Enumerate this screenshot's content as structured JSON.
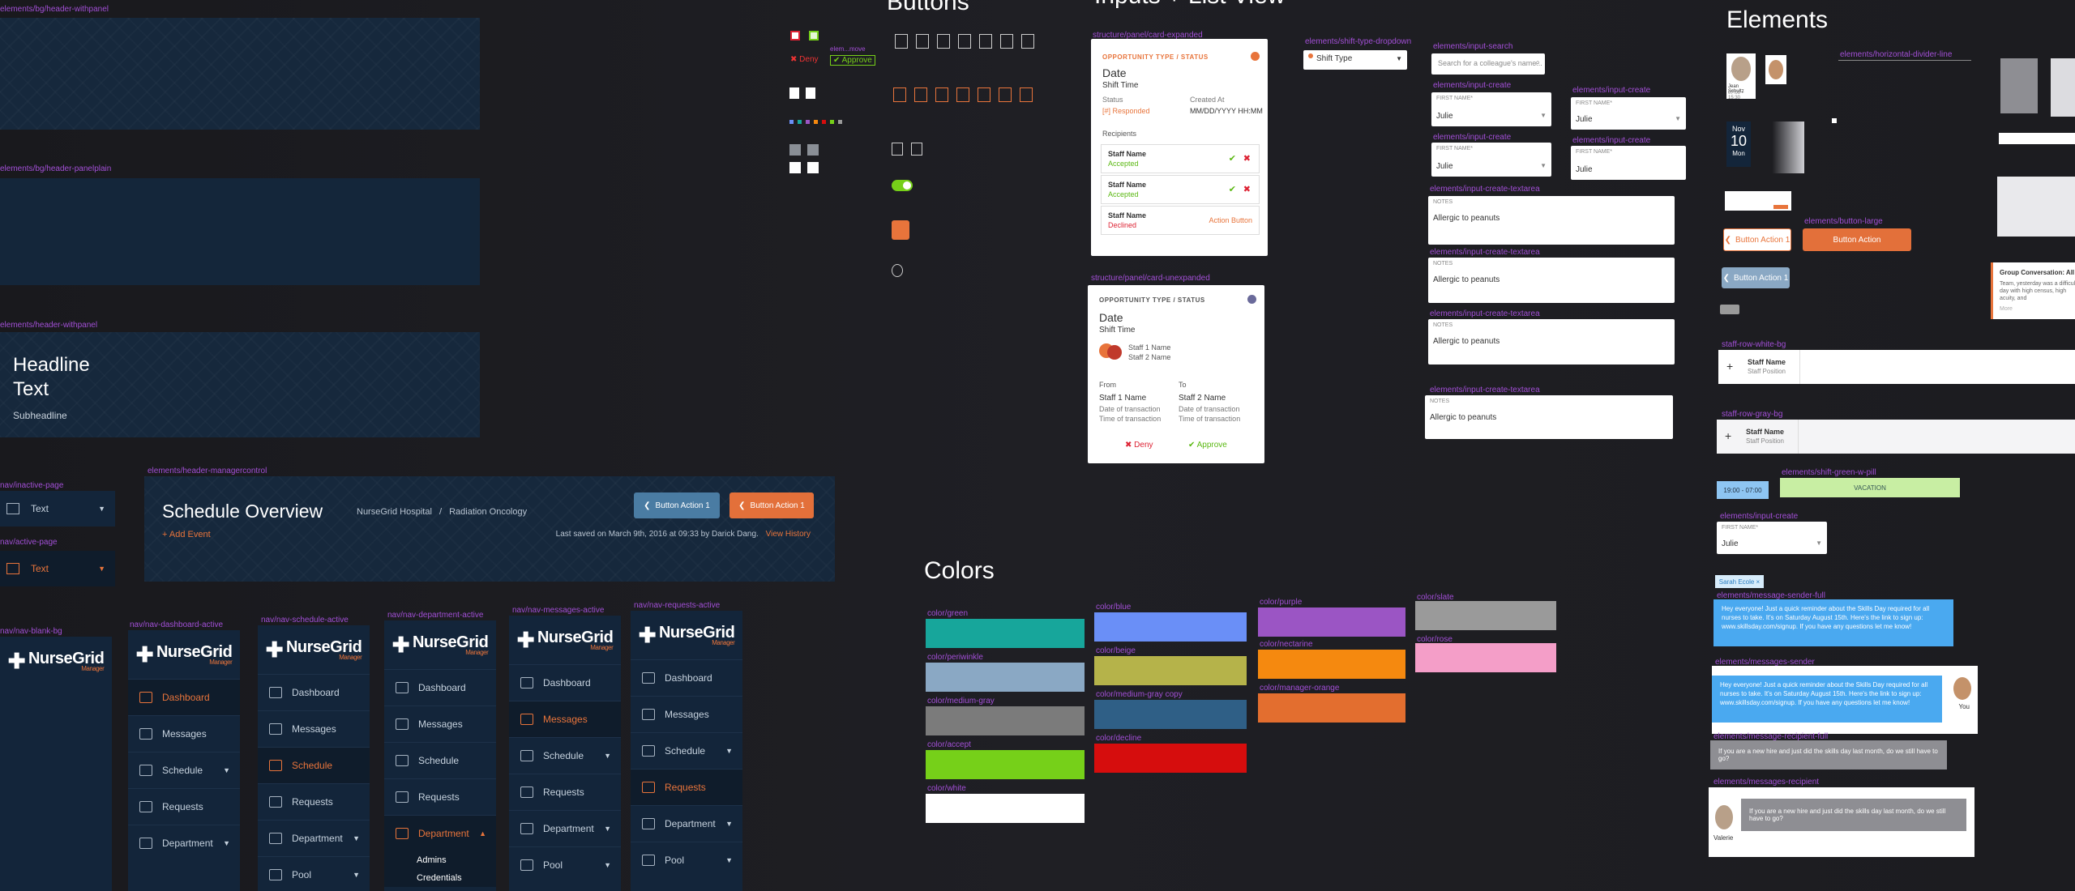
{
  "labels": {
    "bg_withpanel": "elements/bg/header-withpanel",
    "bg_panelplain": "elements/bg/header-panelplain",
    "header_withpanel": "elements/header-withpanel",
    "nav_inactive": "nav/inactive-page",
    "nav_active": "nav/active-page",
    "header_manager": "elements/header-managercontrol",
    "nav_blank": "nav/nav-blank-bg",
    "nav_dashboard": "nav/nav-dashboard-active",
    "nav_schedule": "nav/nav-schedule-active",
    "nav_department": "nav/nav-department-active",
    "nav_messages": "nav/nav-messages-active",
    "nav_requests": "nav/nav-requests-active",
    "card_expanded": "structure/panel/card-expanded",
    "card_unexpanded": "structure/panel/card-unexpanded",
    "shift_dropdown": "elements/shift-type-dropdown",
    "input_search": "elements/input-search",
    "input_create": "elements/input-create",
    "input_textarea": "elements/input-create-textarea",
    "hr": "elements/horizontal-divider-line",
    "button_large": "elements/button-large",
    "staff_row_white": "staff-row-white-bg",
    "staff_row_gray": "staff-row-gray-bg",
    "shift_green": "elements/shift-green-w-pill",
    "input_create2": "elements/input-create",
    "msg_sender_full": "elements/message-sender-full",
    "msg_sender": "elements/messages-sender",
    "msg_recipient_full": "elements/message-recipient-full",
    "msg_recipient": "elements/messages-recipient",
    "color_green": "color/green",
    "color_blue": "color/blue",
    "color_purple": "color/purple",
    "color_slate": "color/slate",
    "color_periwinkle": "color/periwinkle",
    "color_beige": "color/beige",
    "color_nectarine": "color/nectarine",
    "color_rose": "color/rose",
    "color_mediumgray": "color/medium-gray",
    "color_mediumgray_copy": "color/medium-gray copy",
    "color_manager_orange": "color/manager-orange",
    "color_accept": "color/accept",
    "color_decline": "color/decline",
    "color_white": "color/white",
    "elem_deny": "elem...move"
  },
  "headings": {
    "buttons": "Buttons",
    "inputs": "Inputs + List View",
    "colors": "Colors",
    "elements": "Elements"
  },
  "header_withpanel": {
    "headline": "Headline Text",
    "subheadline": "Subheadline"
  },
  "nav_single": {
    "text": "Text"
  },
  "manager_header": {
    "title": "Schedule Overview",
    "hospital": "NurseGrid Hospital",
    "separator": "/",
    "department": "Radiation Oncology",
    "add_event": "+ Add Event",
    "button1": "Button Action 1",
    "button2": "Button Action 1",
    "last_saved": "Last saved on March 9th, 2016 at 09:33 by Darick Dang.",
    "view_history": "View History"
  },
  "nav_logo": {
    "name": "NurseGrid",
    "sub": "Manager"
  },
  "nav_items": {
    "dashboard": "Dashboard",
    "messages": "Messages",
    "schedule": "Schedule",
    "requests": "Requests",
    "department": "Department",
    "pool": "Pool",
    "admins": "Admins",
    "credentials": "Credentials"
  },
  "card_expanded": {
    "type": "OPPORTUNITY TYPE / STATUS",
    "date": "Date",
    "shift_time": "Shift Time",
    "status_label": "Status",
    "status_value": "[#] Responded",
    "created_label": "Created At",
    "created_value": "MM/DD/YYYY  HH:MM",
    "recipients": "Recipients",
    "staff1": "Staff Name",
    "staff1_status": "Accepted",
    "staff2": "Staff Name",
    "staff2_status": "Accepted",
    "staff3": "Staff Name",
    "staff3_status": "Declined",
    "action": "Action Button"
  },
  "card_unexpanded": {
    "type": "OPPORTUNITY TYPE / STATUS",
    "date": "Date",
    "shift_time": "Shift Time",
    "staff1": "Staff 1 Name",
    "staff2": "Staff 2 Name",
    "from": "From",
    "to": "To",
    "from_name": "Staff 1 Name",
    "to_name": "Staff 2 Name",
    "date_tx": "Date of transaction",
    "time_tx": "Time of transaction",
    "deny": "Deny",
    "approve": "Approve"
  },
  "buttons_area": {
    "deny": "Deny",
    "approve": "Approve"
  },
  "dropdown": {
    "value": "Shift Type"
  },
  "search": {
    "placeholder": "Search for a colleague's name..."
  },
  "input_create": {
    "label": "FIRST NAME*",
    "value": "Julie"
  },
  "textarea": {
    "label": "NOTES",
    "value": "Allergic to peanuts"
  },
  "elements_panel": {
    "btn_outline": "Button Action 1",
    "btn_large": "Button Action",
    "btn_back": "Button Action 1",
    "staff_name": "Staff Name",
    "staff_position": "Staff Position",
    "shift_time": "19:00 - 07:00",
    "vacation": "VACATION",
    "first_name_label": "FIRST NAME*",
    "first_name_value": "Julie",
    "sarah_pill": "Sarah Ecole ×",
    "sender_msg": "Hey everyone! Just a quick reminder about the Skills Day required for all nurses to take. It's on Saturday August 15th. Here's the link to sign up: www.skillsday.com/signup. If you have any questions let me know!",
    "recipient_msg": "If you are a new hire and just did the skills day last month, do we still have to go?",
    "you": "You",
    "valerie": "Valerie",
    "date_month": "Nov",
    "date_day": "10",
    "date_dow": "Mon",
    "avatar_name": "Jean Schultz",
    "avatar_time": "07:00 - 15:30",
    "group_title": "Group Conversation: All",
    "group_body": "Team, yesterday was a difficult day with high census, high acuity, and",
    "group_more": "More"
  },
  "colors": {
    "green": "#17a69b",
    "blue": "#6a8ff7",
    "purple": "#9b55c4",
    "slate": "#9a9a9a",
    "periwinkle": "#8aa8c4",
    "beige": "#b5b34a",
    "nectarine": "#f5890f",
    "rose": "#f49ec8",
    "mediumgray": "#7b7b7b",
    "mediumgray_copy": "#2f5f86",
    "manager_orange": "#e36e2f",
    "accept": "#76d019",
    "decline": "#d60d0d",
    "white": "#ffffff"
  }
}
